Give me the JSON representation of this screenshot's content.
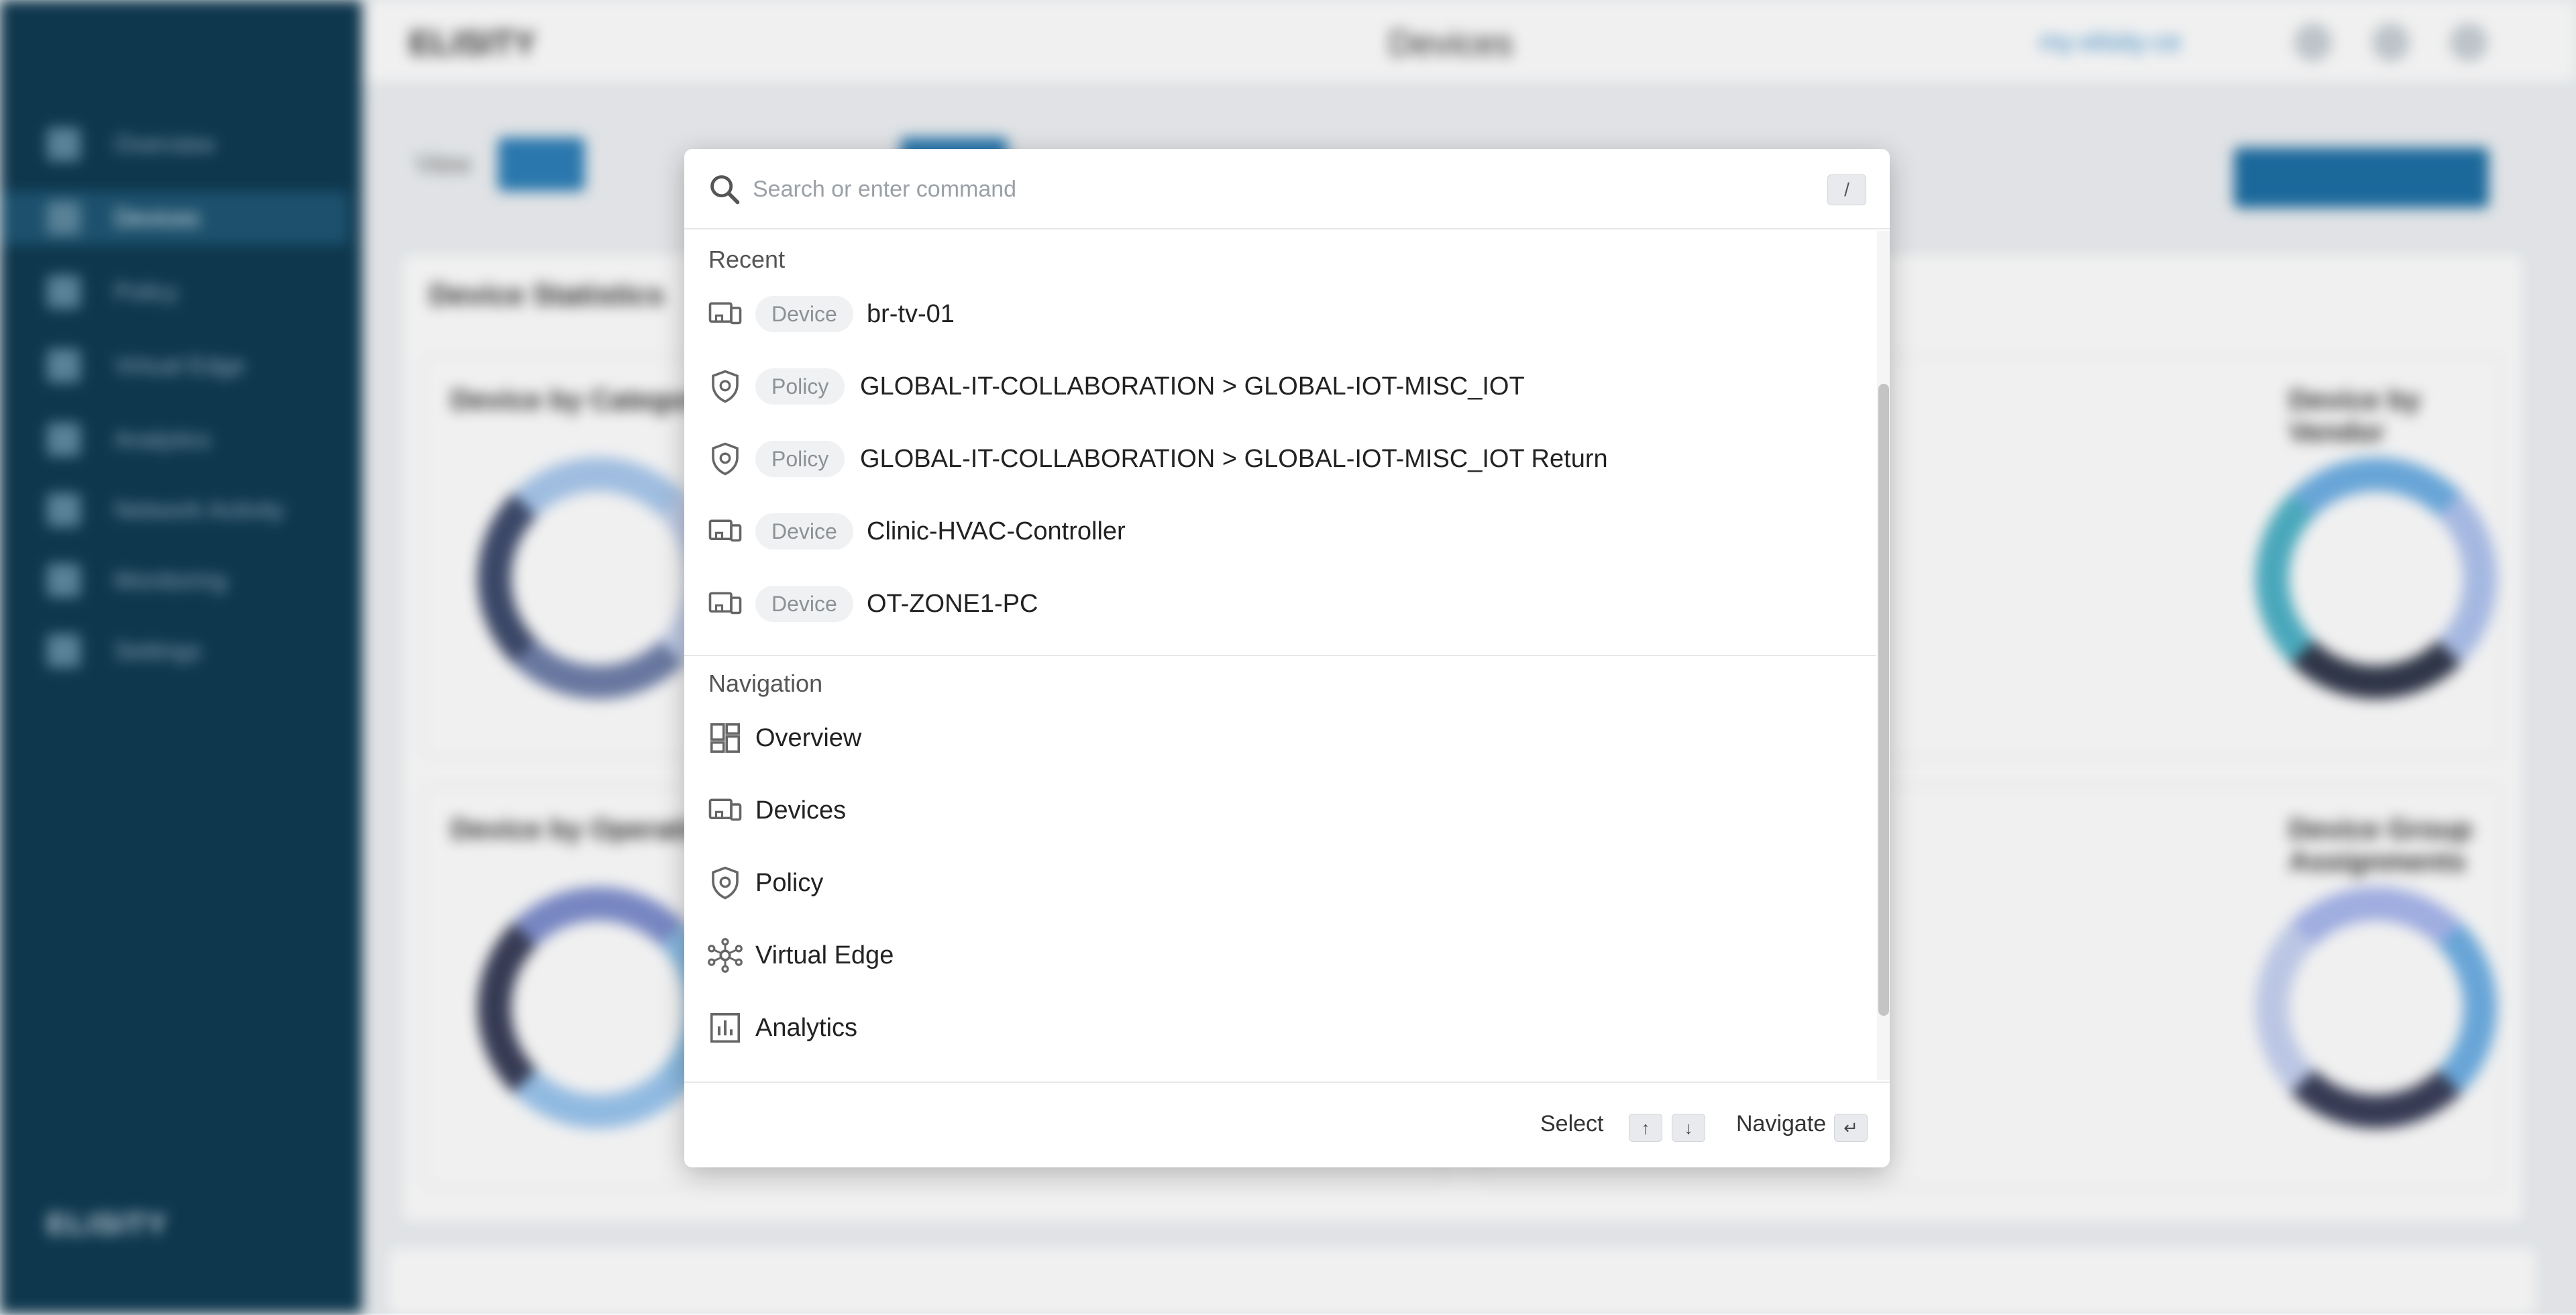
{
  "background": {
    "sidebar_logo": "ELISITY",
    "sidebar_items": [
      "Overview",
      "Devices",
      "Policy",
      "Virtual Edge",
      "Analytics",
      "Network Activity",
      "Monitoring",
      "Settings"
    ],
    "topbar_logo": "ELISITY",
    "page_title": "Devices",
    "org_label": "my-elisity-ce",
    "panel_title": "Device Statistics",
    "filter_label": "View",
    "card_titles": [
      "Device by Category",
      "Device by Vendor",
      "Device by Operating System",
      "Device Group Assignments"
    ]
  },
  "search": {
    "placeholder": "Search or enter command",
    "shortcut_key": "/"
  },
  "recent": {
    "title": "Recent",
    "items": [
      {
        "badge": "Device",
        "label": "br-tv-01",
        "icon": "device-icon"
      },
      {
        "badge": "Policy",
        "label": "GLOBAL-IT-COLLABORATION > GLOBAL-IOT-MISC_IOT",
        "icon": "policy-icon"
      },
      {
        "badge": "Policy",
        "label": "GLOBAL-IT-COLLABORATION > GLOBAL-IOT-MISC_IOT Return",
        "icon": "policy-icon"
      },
      {
        "badge": "Device",
        "label": "Clinic-HVAC-Controller",
        "icon": "device-icon"
      },
      {
        "badge": "Device",
        "label": "OT-ZONE1-PC",
        "icon": "device-icon"
      }
    ]
  },
  "navigation": {
    "title": "Navigation",
    "items": [
      {
        "label": "Overview",
        "icon": "overview-icon"
      },
      {
        "label": "Devices",
        "icon": "devices-icon"
      },
      {
        "label": "Policy",
        "icon": "policy-icon"
      },
      {
        "label": "Virtual Edge",
        "icon": "virtual-edge-icon"
      },
      {
        "label": "Analytics",
        "icon": "analytics-icon"
      }
    ]
  },
  "footer": {
    "select_label": "Select",
    "up_key": "↑",
    "down_key": "↓",
    "navigate_label": "Navigate",
    "enter_key": "↵"
  },
  "colors": {
    "sidebar": "#0f3a52",
    "accent": "#2d7fb8",
    "icon_gray": "#6b6f74"
  }
}
